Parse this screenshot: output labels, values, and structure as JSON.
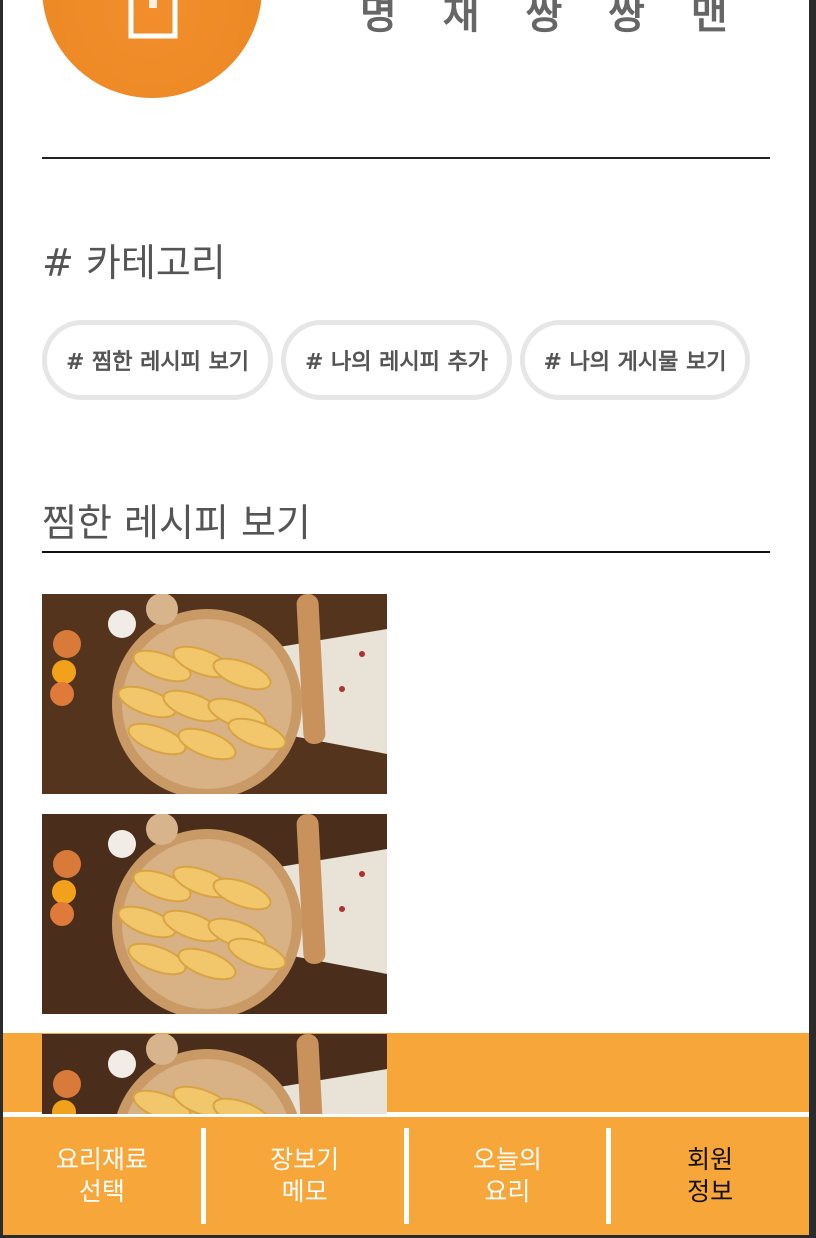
{
  "profile": {
    "name": "명 재 쌍 쌍 맨",
    "avatar_icon": "chef-hat-icon",
    "avatar_color": "#f08a28"
  },
  "category": {
    "title": "# 카테고리",
    "chips": [
      {
        "label": "# 찜한 레시피 보기"
      },
      {
        "label": "# 나의 레시피 추가"
      },
      {
        "label": "# 나의 게시물 보기"
      }
    ]
  },
  "favorites": {
    "title": "찜한 레시피 보기",
    "items": [
      {
        "image": "dumplings-photo"
      },
      {
        "image": "dumplings-photo"
      },
      {
        "image": "dumplings-photo"
      }
    ]
  },
  "bottom_nav": {
    "color": "#f7a63a",
    "items": [
      {
        "line1": "요리재료",
        "line2": "선택",
        "active": false
      },
      {
        "line1": "장보기",
        "line2": "메모",
        "active": false
      },
      {
        "line1": "오늘의",
        "line2": "요리",
        "active": false
      },
      {
        "line1": "회원",
        "line2": "정보",
        "active": true
      }
    ]
  }
}
